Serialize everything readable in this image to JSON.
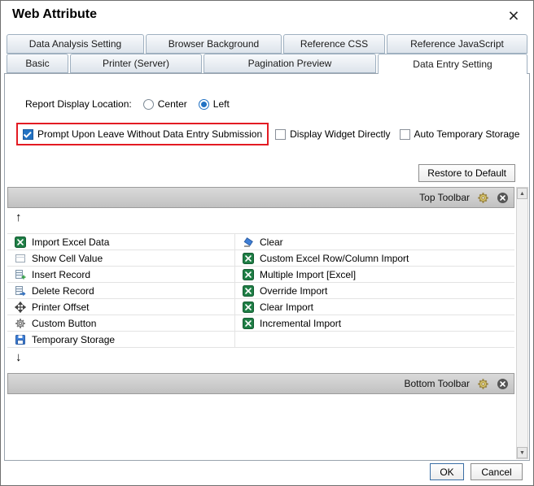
{
  "window": {
    "title": "Web Attribute"
  },
  "tabs": {
    "row1": [
      "Data Analysis Setting",
      "Browser Background",
      "Reference CSS",
      "Reference JavaScript"
    ],
    "row2": [
      "Basic",
      "Printer (Server)",
      "Pagination Preview",
      "Data Entry Setting"
    ],
    "active": "Data Entry Setting"
  },
  "settings": {
    "display_location": {
      "label": "Report Display Location:",
      "options": [
        {
          "label": "Center",
          "selected": false
        },
        {
          "label": "Left",
          "selected": true
        }
      ]
    },
    "checkboxes": [
      {
        "label": "Prompt Upon Leave Without Data Entry Submission",
        "checked": true,
        "highlighted": true
      },
      {
        "label": "Display Widget Directly",
        "checked": false
      },
      {
        "label": "Auto Temporary Storage",
        "checked": false
      }
    ],
    "restore_button_label": "Restore to Default"
  },
  "toolbars": {
    "top_label": "Top Toolbar",
    "bottom_label": "Bottom Toolbar",
    "icons": [
      "gear-icon",
      "remove-icon"
    ]
  },
  "widget_table": {
    "rows": [
      {
        "left": {
          "label": "Import Excel Data",
          "icon": "excel-icon"
        },
        "right": {
          "label": "Clear",
          "icon": "eraser-icon"
        }
      },
      {
        "left": {
          "label": "Show Cell Value",
          "icon": "cell-icon"
        },
        "right": {
          "label": "Custom Excel Row/Column Import",
          "icon": "excel-icon"
        }
      },
      {
        "left": {
          "label": "Insert Record",
          "icon": "insert-record-icon"
        },
        "right": {
          "label": "Multiple Import [Excel]",
          "icon": "excel-icon"
        }
      },
      {
        "left": {
          "label": "Delete Record",
          "icon": "delete-record-icon"
        },
        "right": {
          "label": "Override Import",
          "icon": "excel-icon"
        }
      },
      {
        "left": {
          "label": "Printer Offset",
          "icon": "move-icon"
        },
        "right": {
          "label": "Clear Import",
          "icon": "excel-icon"
        }
      },
      {
        "left": {
          "label": "Custom Button",
          "icon": "gear-icon"
        },
        "right": {
          "label": "Incremental Import",
          "icon": "excel-icon"
        }
      },
      {
        "left": {
          "label": "Temporary Storage",
          "icon": "storage-icon"
        },
        "right": {
          "label": "",
          "icon": ""
        }
      }
    ]
  },
  "footer": {
    "ok": "OK",
    "cancel": "Cancel"
  },
  "colors": {
    "accent": "#2272c3",
    "highlight_red": "#e31b23",
    "excel_green": "#1e7e45",
    "toolbar_gray": "#c9c9c9"
  }
}
